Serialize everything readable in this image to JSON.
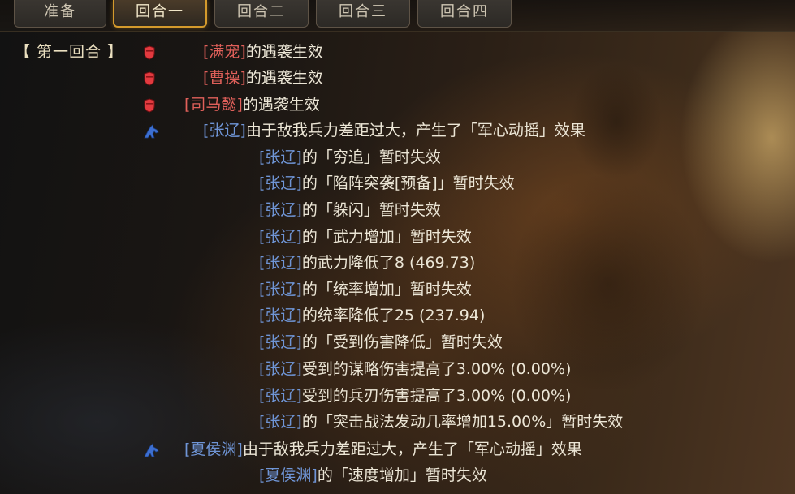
{
  "tabs": [
    {
      "label": "准备",
      "active": false
    },
    {
      "label": "回合一",
      "active": true
    },
    {
      "label": "回合二",
      "active": false
    },
    {
      "label": "回合三",
      "active": false
    },
    {
      "label": "回合四",
      "active": false
    }
  ],
  "round_label": "【 第一回合 】",
  "icons": {
    "shield": "red-shield-icon",
    "horse": "blue-horse-icon"
  },
  "colors": {
    "enemy_name": "#e0605a",
    "ally_name": "#6f95d6",
    "active_tab_border": "#d49a2c"
  },
  "log": [
    {
      "icon": "shield",
      "name": "[满宠]",
      "name_color": "red",
      "text": "的遇袭生效"
    },
    {
      "icon": "shield",
      "name": "[曹操]",
      "name_color": "red",
      "text": "的遇袭生效"
    },
    {
      "icon": "shield",
      "name": "[司马懿]",
      "name_color": "red",
      "text": "的遇袭生效"
    },
    {
      "icon": "horse",
      "name": "[张辽]",
      "name_color": "blue",
      "text": "由于敌我兵力差距过大，产生了「军心动摇」效果"
    },
    {
      "icon": "",
      "name": "[张辽]",
      "name_color": "blue",
      "text": "的「穷追」暂时失效"
    },
    {
      "icon": "",
      "name": "[张辽]",
      "name_color": "blue",
      "text": "的「陷阵突袭[预备]」暂时失效"
    },
    {
      "icon": "",
      "name": "[张辽]",
      "name_color": "blue",
      "text": "的「躲闪」暂时失效"
    },
    {
      "icon": "",
      "name": "[张辽]",
      "name_color": "blue",
      "text": "的「武力增加」暂时失效"
    },
    {
      "icon": "",
      "name": "[张辽]",
      "name_color": "blue",
      "text": "的武力降低了8 (469.73)"
    },
    {
      "icon": "",
      "name": "[张辽]",
      "name_color": "blue",
      "text": "的「统率增加」暂时失效"
    },
    {
      "icon": "",
      "name": "[张辽]",
      "name_color": "blue",
      "text": "的统率降低了25 (237.94)"
    },
    {
      "icon": "",
      "name": "[张辽]",
      "name_color": "blue",
      "text": "的「受到伤害降低」暂时失效"
    },
    {
      "icon": "",
      "name": "[张辽]",
      "name_color": "blue",
      "text": "受到的谋略伤害提高了3.00% (0.00%)"
    },
    {
      "icon": "",
      "name": "[张辽]",
      "name_color": "blue",
      "text": "受到的兵刃伤害提高了3.00% (0.00%)"
    },
    {
      "icon": "",
      "name": "[张辽]",
      "name_color": "blue",
      "text": "的「突击战法发动几率增加15.00%」暂时失效"
    },
    {
      "icon": "horse",
      "name": "[夏侯渊]",
      "name_color": "blue",
      "text": "由于敌我兵力差距过大，产生了「军心动摇」效果"
    },
    {
      "icon": "",
      "name": "[夏侯渊]",
      "name_color": "blue",
      "text": "的「速度增加」暂时失效"
    }
  ]
}
